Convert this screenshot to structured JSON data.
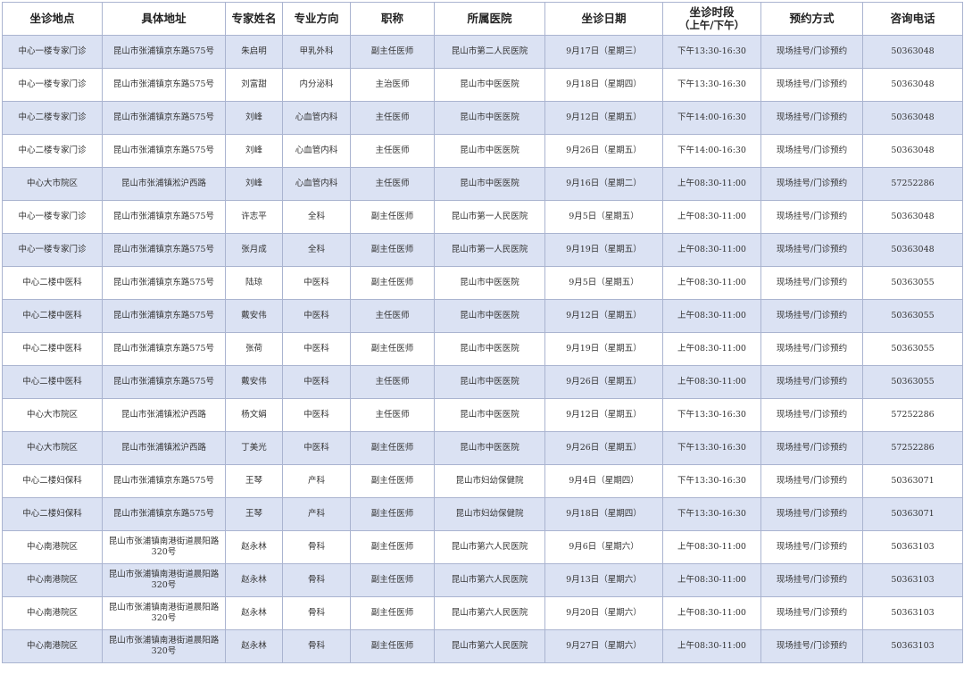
{
  "columns": [
    {
      "label": "坐诊地点"
    },
    {
      "label": "具体地址"
    },
    {
      "label": "专家姓名"
    },
    {
      "label": "专业方向"
    },
    {
      "label": "职称"
    },
    {
      "label": "所属医院"
    },
    {
      "label": "坐诊日期"
    },
    {
      "label": "坐诊时段",
      "sub": "（上午/下午）"
    },
    {
      "label": "预约方式"
    },
    {
      "label": "咨询电话"
    }
  ],
  "rows": [
    [
      "中心一楼专家门诊",
      "昆山市张浦镇京东路575号",
      "朱启明",
      "甲乳外科",
      "副主任医师",
      "昆山市第二人民医院",
      "9月17日（星期三）",
      "下午13:30-16:30",
      "现场挂号/门诊预约",
      "50363048"
    ],
    [
      "中心一楼专家门诊",
      "昆山市张浦镇京东路575号",
      "刘富甜",
      "内分泌科",
      "主治医师",
      "昆山市中医医院",
      "9月18日（星期四）",
      "下午13:30-16:30",
      "现场挂号/门诊预约",
      "50363048"
    ],
    [
      "中心二楼专家门诊",
      "昆山市张浦镇京东路575号",
      "刘峰",
      "心血管内科",
      "主任医师",
      "昆山市中医医院",
      "9月12日（星期五）",
      "下午14:00-16:30",
      "现场挂号/门诊预约",
      "50363048"
    ],
    [
      "中心二楼专家门诊",
      "昆山市张浦镇京东路575号",
      "刘峰",
      "心血管内科",
      "主任医师",
      "昆山市中医医院",
      "9月26日（星期五）",
      "下午14:00-16:30",
      "现场挂号/门诊预约",
      "50363048"
    ],
    [
      "中心大市院区",
      "昆山市张浦镇淞沪西路",
      "刘峰",
      "心血管内科",
      "主任医师",
      "昆山市中医医院",
      "9月16日（星期二）",
      "上午08:30-11:00",
      "现场挂号/门诊预约",
      "57252286"
    ],
    [
      "中心一楼专家门诊",
      "昆山市张浦镇京东路575号",
      "许志平",
      "全科",
      "副主任医师",
      "昆山市第一人民医院",
      "9月5日（星期五）",
      "上午08:30-11:00",
      "现场挂号/门诊预约",
      "50363048"
    ],
    [
      "中心一楼专家门诊",
      "昆山市张浦镇京东路575号",
      "张月成",
      "全科",
      "副主任医师",
      "昆山市第一人民医院",
      "9月19日（星期五）",
      "上午08:30-11:00",
      "现场挂号/门诊预约",
      "50363048"
    ],
    [
      "中心二楼中医科",
      "昆山市张浦镇京东路575号",
      "陆琼",
      "中医科",
      "副主任医师",
      "昆山市中医医院",
      "9月5日（星期五）",
      "上午08:30-11:00",
      "现场挂号/门诊预约",
      "50363055"
    ],
    [
      "中心二楼中医科",
      "昆山市张浦镇京东路575号",
      "戴安伟",
      "中医科",
      "主任医师",
      "昆山市中医医院",
      "9月12日（星期五）",
      "上午08:30-11:00",
      "现场挂号/门诊预约",
      "50363055"
    ],
    [
      "中心二楼中医科",
      "昆山市张浦镇京东路575号",
      "张荷",
      "中医科",
      "副主任医师",
      "昆山市中医医院",
      "9月19日（星期五）",
      "上午08:30-11:00",
      "现场挂号/门诊预约",
      "50363055"
    ],
    [
      "中心二楼中医科",
      "昆山市张浦镇京东路575号",
      "戴安伟",
      "中医科",
      "主任医师",
      "昆山市中医医院",
      "9月26日（星期五）",
      "上午08:30-11:00",
      "现场挂号/门诊预约",
      "50363055"
    ],
    [
      "中心大市院区",
      "昆山市张浦镇淞沪西路",
      "杨文娟",
      "中医科",
      "主任医师",
      "昆山市中医医院",
      "9月12日（星期五）",
      "下午13:30-16:30",
      "现场挂号/门诊预约",
      "57252286"
    ],
    [
      "中心大市院区",
      "昆山市张浦镇淞沪西路",
      "丁美光",
      "中医科",
      "副主任医师",
      "昆山市中医医院",
      "9月26日（星期五）",
      "下午13:30-16:30",
      "现场挂号/门诊预约",
      "57252286"
    ],
    [
      "中心二楼妇保科",
      "昆山市张浦镇京东路575号",
      "王琴",
      "产科",
      "副主任医师",
      "昆山市妇幼保健院",
      "9月4日（星期四）",
      "下午13:30-16:30",
      "现场挂号/门诊预约",
      "50363071"
    ],
    [
      "中心二楼妇保科",
      "昆山市张浦镇京东路575号",
      "王琴",
      "产科",
      "副主任医师",
      "昆山市妇幼保健院",
      "9月18日（星期四）",
      "下午13:30-16:30",
      "现场挂号/门诊预约",
      "50363071"
    ],
    [
      "中心南港院区",
      "昆山市张浦镇南港街道晨阳路320号",
      "赵永林",
      "骨科",
      "副主任医师",
      "昆山市第六人民医院",
      "9月6日（星期六）",
      "上午08:30-11:00",
      "现场挂号/门诊预约",
      "50363103"
    ],
    [
      "中心南港院区",
      "昆山市张浦镇南港街道晨阳路320号",
      "赵永林",
      "骨科",
      "副主任医师",
      "昆山市第六人民医院",
      "9月13日（星期六）",
      "上午08:30-11:00",
      "现场挂号/门诊预约",
      "50363103"
    ],
    [
      "中心南港院区",
      "昆山市张浦镇南港街道晨阳路320号",
      "赵永林",
      "骨科",
      "副主任医师",
      "昆山市第六人民医院",
      "9月20日（星期六）",
      "上午08:30-11:00",
      "现场挂号/门诊预约",
      "50363103"
    ],
    [
      "中心南港院区",
      "昆山市张浦镇南港街道晨阳路320号",
      "赵永林",
      "骨科",
      "副主任医师",
      "昆山市第六人民医院",
      "9月27日（星期六）",
      "上午08:30-11:00",
      "现场挂号/门诊预约",
      "50363103"
    ]
  ]
}
